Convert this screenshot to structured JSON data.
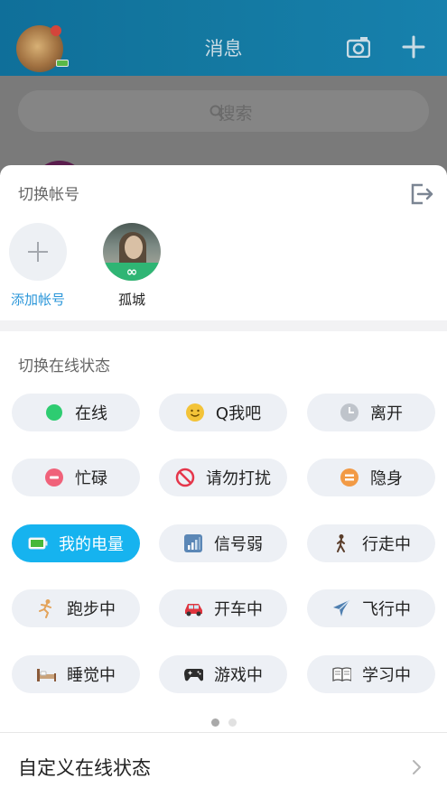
{
  "header": {
    "title": "消息"
  },
  "search": {
    "placeholder": "搜索"
  },
  "sheet": {
    "switch_account_title": "切换帐号",
    "add_account_label": "添加帐号",
    "account_name": "孤城",
    "account_badge": "∞",
    "switch_status_title": "切换在线状态",
    "statuses": [
      {
        "label": "在线",
        "icon": "green-dot-icon",
        "color": "#2ecc71"
      },
      {
        "label": "Q我吧",
        "icon": "smiley-icon",
        "color": "#f3c338"
      },
      {
        "label": "离开",
        "icon": "clock-icon",
        "color": "#bfc4cb"
      },
      {
        "label": "忙碌",
        "icon": "minus-circle-icon",
        "color": "#f0627a"
      },
      {
        "label": "请勿打扰",
        "icon": "no-entry-icon",
        "color": "#e5364b"
      },
      {
        "label": "隐身",
        "icon": "equals-circle-icon",
        "color": "#f29a45"
      },
      {
        "label": "我的电量",
        "icon": "battery-icon",
        "active": true
      },
      {
        "label": "信号弱",
        "icon": "signal-icon"
      },
      {
        "label": "行走中",
        "icon": "walking-icon"
      },
      {
        "label": "跑步中",
        "icon": "running-icon"
      },
      {
        "label": "开车中",
        "icon": "car-icon"
      },
      {
        "label": "飞行中",
        "icon": "airplane-icon"
      },
      {
        "label": "睡觉中",
        "icon": "bed-icon"
      },
      {
        "label": "游戏中",
        "icon": "gamepad-icon"
      },
      {
        "label": "学习中",
        "icon": "book-icon"
      }
    ],
    "custom_status_label": "自定义在线状态"
  },
  "colors": {
    "accent": "#16b3ef",
    "link": "#2a96d9",
    "header": "#1378a2"
  }
}
